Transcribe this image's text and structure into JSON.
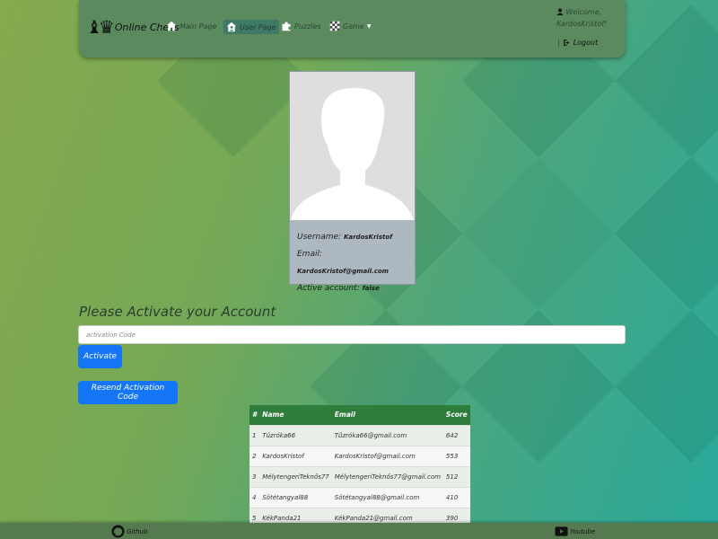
{
  "brand": {
    "name": "Online Chess",
    "pieces": "♝♛"
  },
  "nav": {
    "items": [
      {
        "label": "Main Page",
        "icon": "home-icon"
      },
      {
        "label": "User Page",
        "icon": "user-page-icon"
      },
      {
        "label": "Puzzles",
        "icon": "puzzle-icon"
      },
      {
        "label": "Game",
        "icon": "chessboard-icon"
      }
    ],
    "welcome": "Welcome, KardosKristof!",
    "logout_separator": "|",
    "logout": "Logout"
  },
  "profile": {
    "username_label": "Username:",
    "username": "KardosKristof",
    "email_label": "Email:",
    "email": "KardosKristof@gmail.com",
    "active_label": "Active account:",
    "active": "false"
  },
  "activation": {
    "title": "Please Activate your Account",
    "placeholder": "activation Code",
    "value": "",
    "activate_button": "Activate",
    "resend_button": "Resend Activation Code"
  },
  "leaderboard": {
    "headers": [
      "#",
      "Name",
      "Email",
      "Score"
    ],
    "rows": [
      [
        "1",
        "Tűzróka66",
        "Tűzróka66@gmail.com",
        "642"
      ],
      [
        "2",
        "KardosKristof",
        "KardosKristof@gmail.com",
        "553"
      ],
      [
        "3",
        "MélytengeriTeknős77",
        "MélytengeriTeknős77@gmail.com",
        "512"
      ],
      [
        "4",
        "Sötétangyal88",
        "Sötétangyal88@gmail.com",
        "410"
      ],
      [
        "5",
        "KékPanda21",
        "KékPanda21@gmail.com",
        "390"
      ]
    ]
  },
  "footer": {
    "github": "Github",
    "youtube": "Youtube"
  },
  "colors": {
    "navbar": "#5a8a5e",
    "button": "#1475f6",
    "table_header": "#2e7d3b"
  }
}
